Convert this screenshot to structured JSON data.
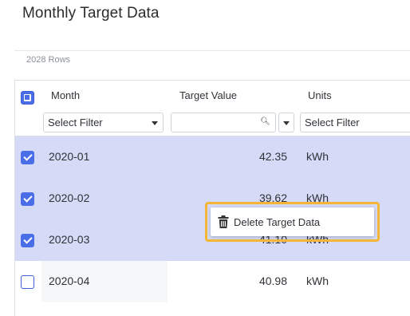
{
  "page": {
    "title": "Monthly Target Data"
  },
  "table": {
    "row_count": "2028 Rows",
    "columns": [
      {
        "label": "Month",
        "filter": "Select Filter"
      },
      {
        "label": "Target Value",
        "filter": ""
      },
      {
        "label": "Units",
        "filter": "Select Filter"
      }
    ],
    "rows": [
      {
        "month": "2020-01",
        "value": "42.35",
        "units": "kWh",
        "selected": true
      },
      {
        "month": "2020-02",
        "value": "39.62",
        "units": "kWh",
        "selected": true
      },
      {
        "month": "2020-03",
        "value": "41.10",
        "units": "kWh",
        "selected": true
      },
      {
        "month": "2020-04",
        "value": "40.98",
        "units": "kWh",
        "selected": false
      }
    ]
  },
  "context_menu": {
    "item_label": "Delete Target Data",
    "icon": "trash-icon",
    "highlight_color": "#f5b636"
  },
  "colors": {
    "selected_row": "#d5daf7",
    "checkbox_accent": "#4b6ee8"
  }
}
